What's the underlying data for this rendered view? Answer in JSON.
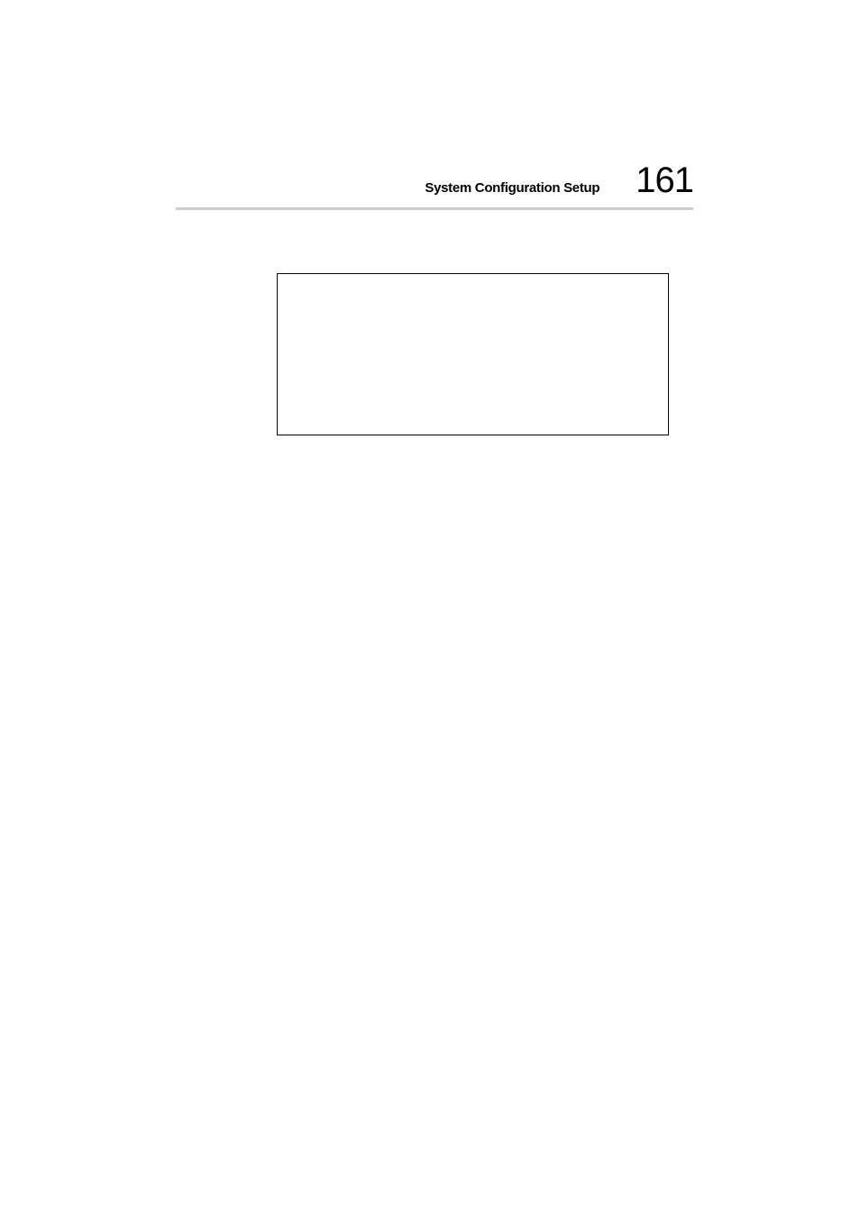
{
  "header": {
    "section_title": "System Configuration Setup",
    "page_number": "161"
  }
}
